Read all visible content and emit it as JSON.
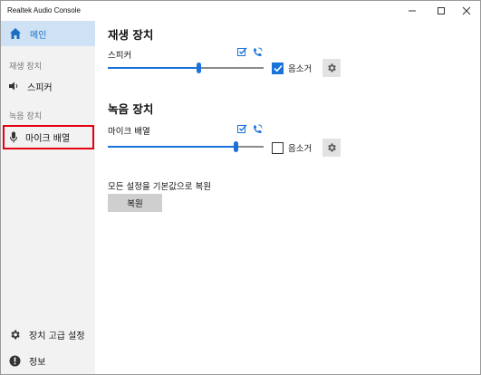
{
  "window": {
    "title": "Realtek Audio Console"
  },
  "sidebar": {
    "home_label": "메인",
    "playback_section": "재생 장치",
    "playback_item": "스피커",
    "recording_section": "녹음 장치",
    "recording_item": "마이크 배열",
    "advanced_label": "장치 고급 설정",
    "info_label": "정보"
  },
  "main": {
    "playback_heading": "재생 장치",
    "recording_heading": "녹음 장치",
    "speaker": {
      "name": "스피커",
      "volume": 0.58,
      "muted": true,
      "mute_label": "음소거"
    },
    "mic": {
      "name": "마이크 배열",
      "volume": 0.82,
      "muted": false,
      "mute_label": "음소거"
    },
    "reset_text": "모든 설정을 기본값으로 복원",
    "reset_button": "복원"
  },
  "colors": {
    "accent": "#1a73d9",
    "highlight": "#e3000f",
    "sidebar_selected": "#cfe2f5"
  },
  "icons": [
    "home-icon",
    "speaker-icon",
    "microphone-icon",
    "gear-icon",
    "info-icon",
    "check-edit-icon",
    "phone-icon"
  ]
}
